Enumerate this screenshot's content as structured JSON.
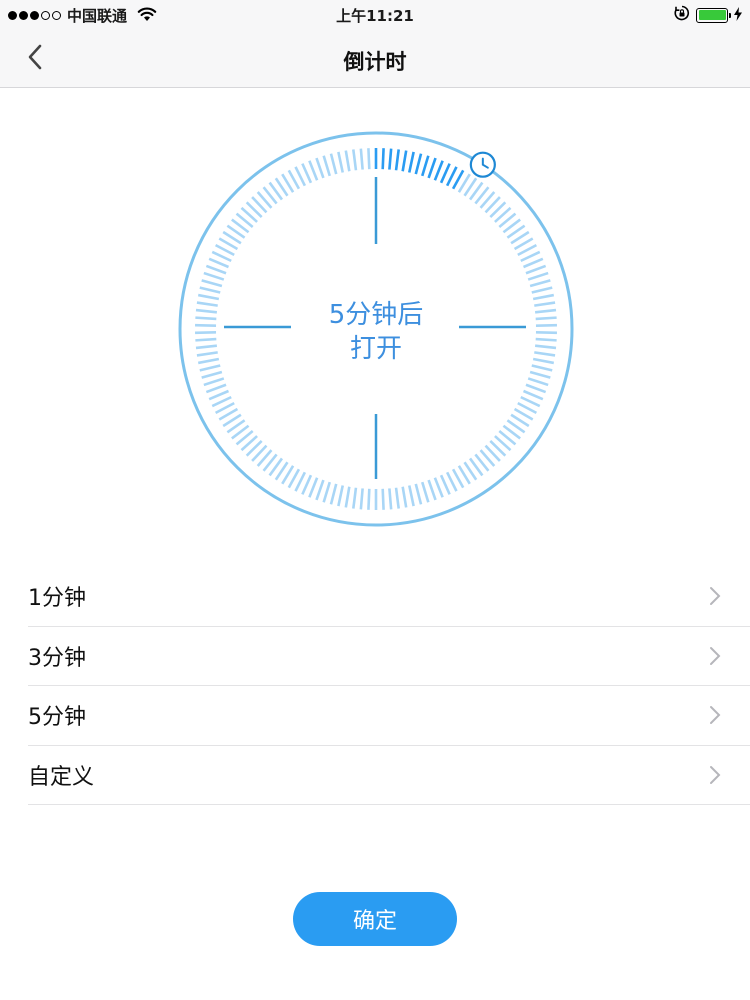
{
  "status_bar": {
    "carrier": "中国联通",
    "time": "上午11:21",
    "battery_color": "#38c93a"
  },
  "nav": {
    "title": "倒计时",
    "back_icon": "chevron-left-icon"
  },
  "dial": {
    "line1": "5分钟后",
    "line2": "打开",
    "progress": 0.083,
    "accent_color": "#2a9cf2",
    "track_color": "#a9d6f6",
    "icon": "clock-icon"
  },
  "options": [
    {
      "label": "1分钟"
    },
    {
      "label": "3分钟"
    },
    {
      "label": "5分钟"
    },
    {
      "label": "自定义"
    }
  ],
  "confirm": {
    "label": "确定",
    "color": "#2a9cf2"
  }
}
